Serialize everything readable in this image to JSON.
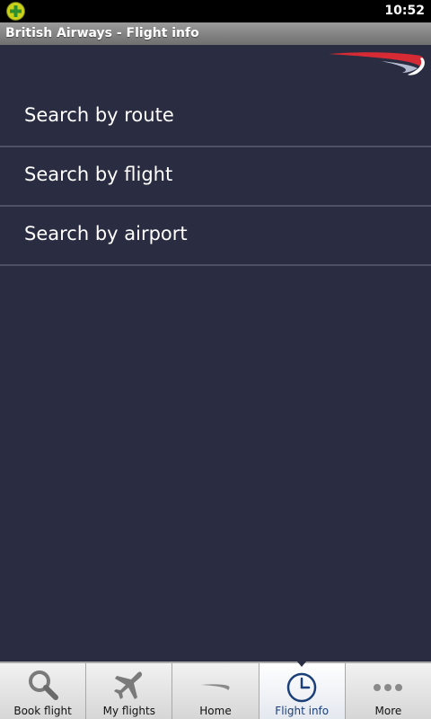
{
  "status_bar": {
    "time": "10:52"
  },
  "title_bar": {
    "title": "British Airways - Flight info"
  },
  "menu": {
    "items": [
      {
        "label": "Search by route"
      },
      {
        "label": "Search by flight"
      },
      {
        "label": "Search by airport"
      }
    ]
  },
  "tabs": [
    {
      "label": "Book flight",
      "icon": "search-icon",
      "active": false
    },
    {
      "label": "My flights",
      "icon": "airplane-icon",
      "active": false
    },
    {
      "label": "Home",
      "icon": "speedmarque-icon",
      "active": false
    },
    {
      "label": "Flight info",
      "icon": "clock-icon",
      "active": true
    },
    {
      "label": "More",
      "icon": "more-dots-icon",
      "active": false
    }
  ],
  "colors": {
    "background": "#2a2d41",
    "active_tab_text": "#1a3f79",
    "logo_red": "#d62b35"
  }
}
